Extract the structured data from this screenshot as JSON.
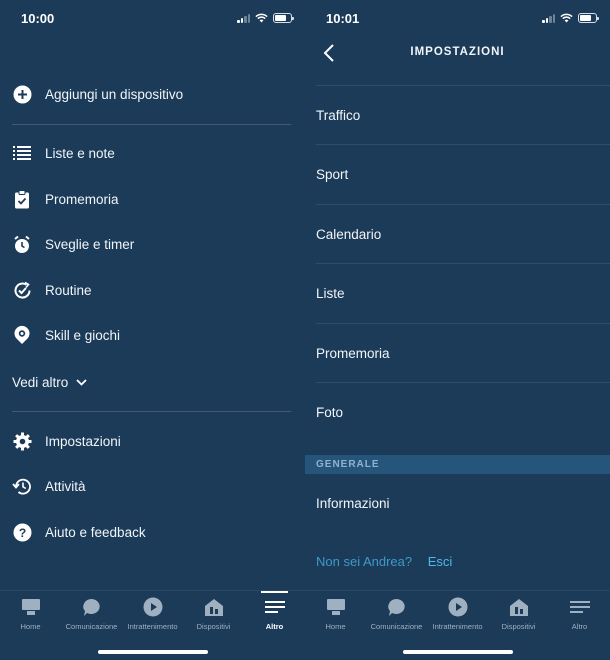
{
  "left": {
    "time": "10:00",
    "menu": [
      {
        "label": "Aggiungi un dispositivo",
        "icon": "plus-circle-icon"
      },
      {
        "label": "Liste e note",
        "icon": "list-icon"
      },
      {
        "label": "Promemoria",
        "icon": "clipboard-check-icon"
      },
      {
        "label": "Sveglie e timer",
        "icon": "alarm-clock-icon"
      },
      {
        "label": "Routine",
        "icon": "routine-check-icon"
      },
      {
        "label": "Skill e giochi",
        "icon": "skill-location-icon"
      },
      {
        "label": "Impostazioni",
        "icon": "gear-icon"
      },
      {
        "label": "Attività",
        "icon": "history-icon"
      },
      {
        "label": "Aiuto e feedback",
        "icon": "help-icon"
      }
    ],
    "see_more": "Vedi altro",
    "tabs": [
      {
        "label": "Home",
        "icon": "home-icon"
      },
      {
        "label": "Comunicazione",
        "icon": "chat-icon"
      },
      {
        "label": "Intrattenimento",
        "icon": "play-icon"
      },
      {
        "label": "Dispositivi",
        "icon": "devices-icon"
      },
      {
        "label": "Altro",
        "icon": "more-menu-icon",
        "active": true
      }
    ]
  },
  "right": {
    "time": "10:01",
    "title": "IMPOSTAZIONI",
    "rows": [
      "Traffico",
      "Sport",
      "Calendario",
      "Liste",
      "Promemoria",
      "Foto"
    ],
    "section": "GENERALE",
    "info_row": "Informazioni",
    "not_you": "Non sei Andrea?",
    "logout": "Esci",
    "tabs": [
      {
        "label": "Home",
        "icon": "home-icon"
      },
      {
        "label": "Comunicazione",
        "icon": "chat-icon"
      },
      {
        "label": "Intrattenimento",
        "icon": "play-icon"
      },
      {
        "label": "Dispositivi",
        "icon": "devices-icon"
      },
      {
        "label": "Altro",
        "icon": "more-menu-icon"
      }
    ]
  },
  "colors": {
    "background": "#1b3b59",
    "section_band": "#25557a",
    "link": "#4fb8ea"
  }
}
